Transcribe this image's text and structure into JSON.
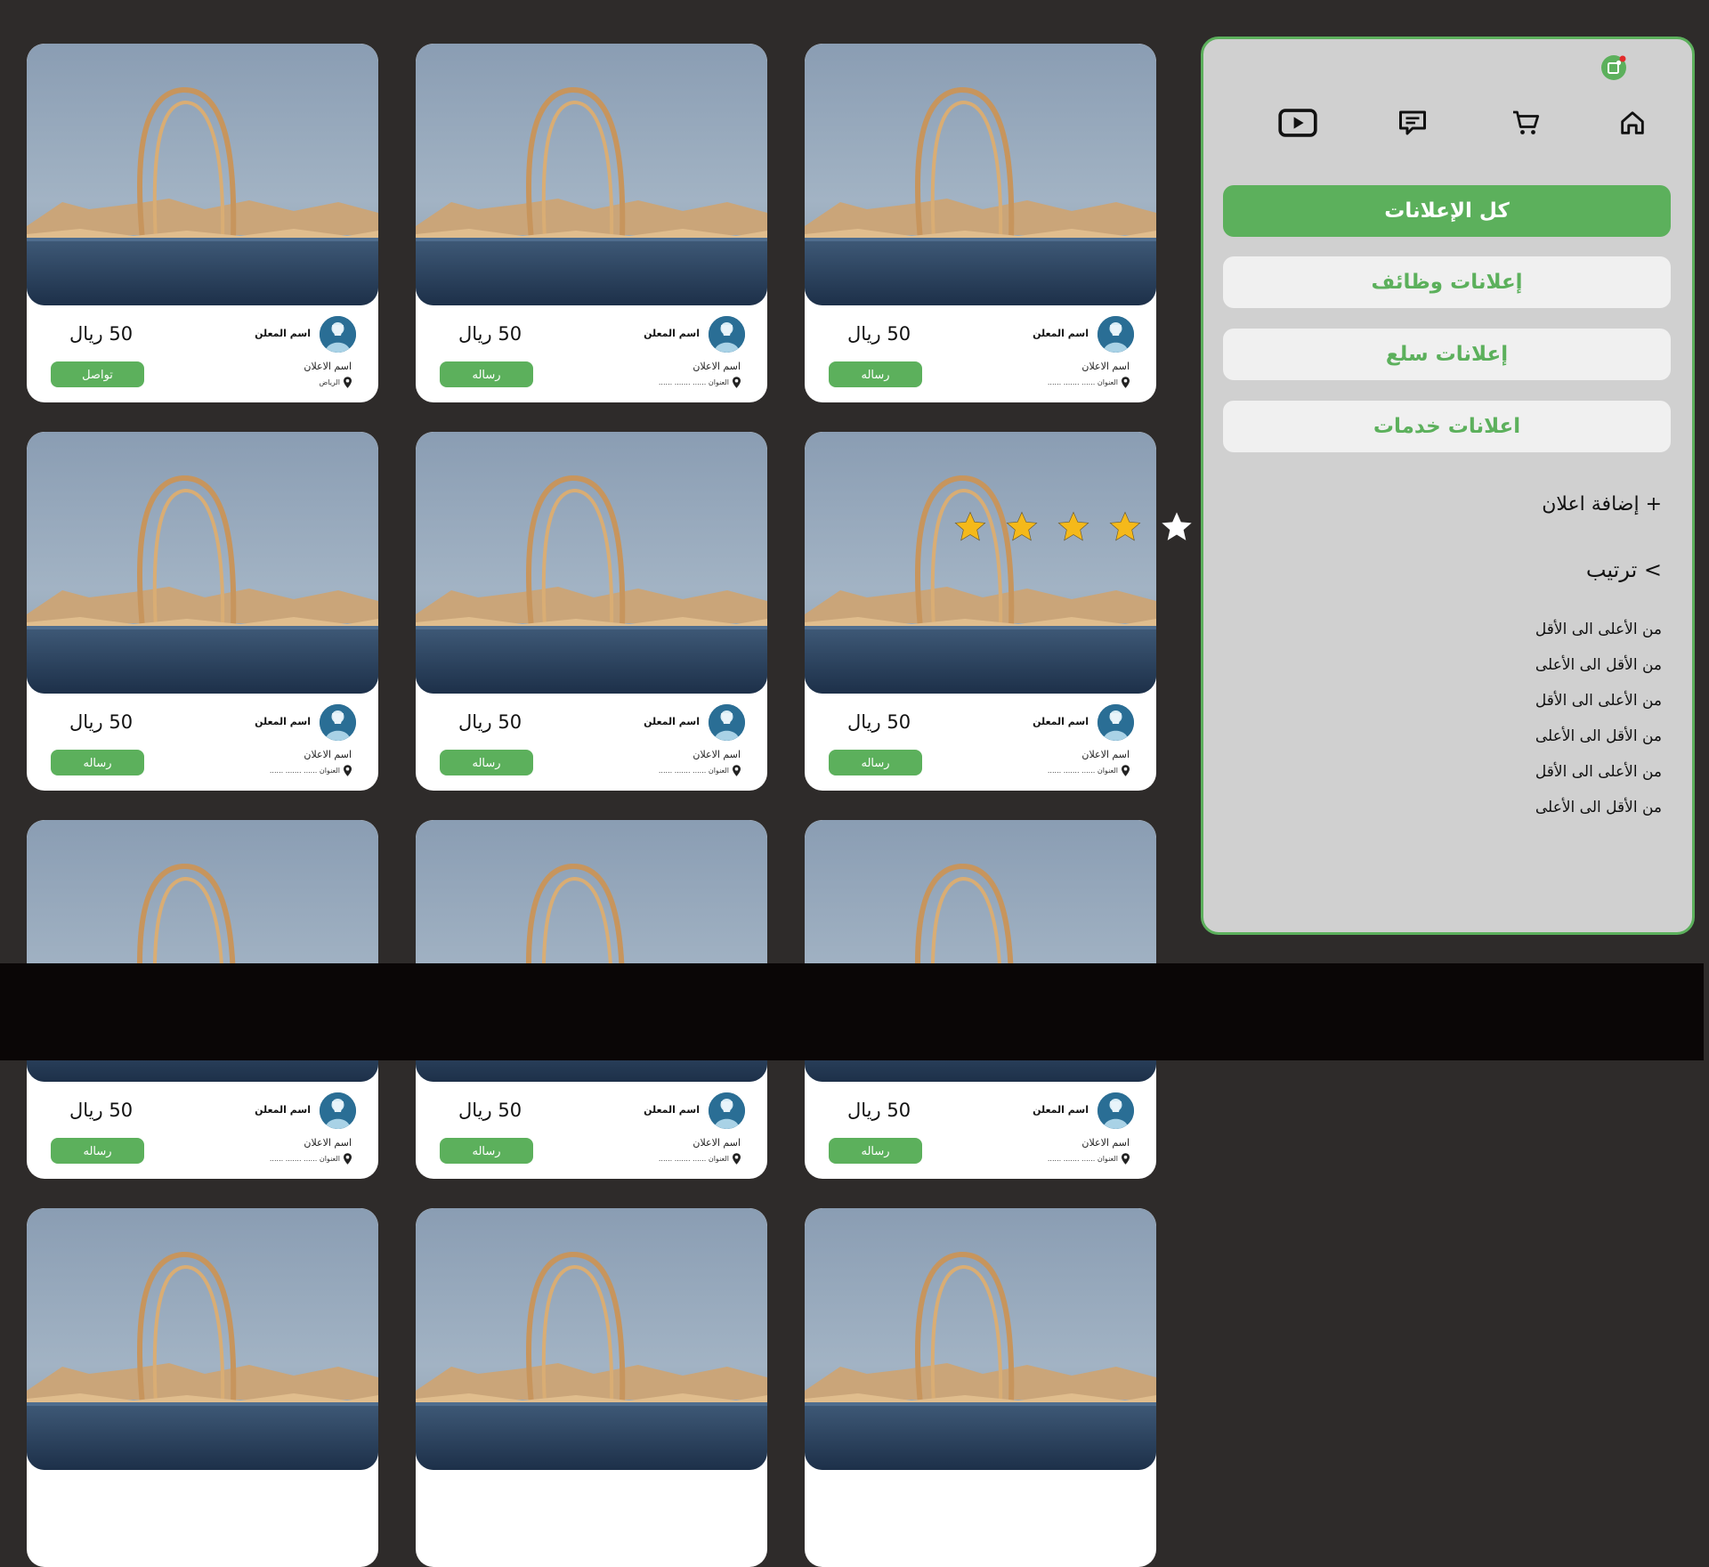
{
  "listings": [
    {
      "seller": "اسم المعلن",
      "price": "50 ريال",
      "ad_name": "اسم الاعلان",
      "address": "الرياض",
      "button": "تواصل"
    },
    {
      "seller": "اسم المعلن",
      "price": "50 ريال",
      "ad_name": "اسم الاعلان",
      "address": "العنوان ...... ....... ......",
      "button": "رساله"
    },
    {
      "seller": "اسم المعلن",
      "price": "50 ريال",
      "ad_name": "اسم الاعلان",
      "address": "العنوان ...... ....... ......",
      "button": "رساله"
    },
    {
      "seller": "اسم المعلن",
      "price": "50 ريال",
      "ad_name": "اسم الاعلان",
      "address": "العنوان ...... ....... ......",
      "button": "رساله"
    },
    {
      "seller": "اسم المعلن",
      "price": "50 ريال",
      "ad_name": "اسم الاعلان",
      "address": "العنوان ...... ....... ......",
      "button": "رساله"
    },
    {
      "seller": "اسم المعلن",
      "price": "50 ريال",
      "ad_name": "اسم الاعلان",
      "address": "العنوان ...... ....... ......",
      "button": "رساله"
    },
    {
      "seller": "اسم المعلن",
      "price": "50 ريال",
      "ad_name": "اسم الاعلان",
      "address": "العنوان ...... ....... ......",
      "button": "رساله"
    },
    {
      "seller": "اسم المعلن",
      "price": "50 ريال",
      "ad_name": "اسم الاعلان",
      "address": "العنوان ...... ....... ......",
      "button": "رساله"
    },
    {
      "seller": "اسم المعلن",
      "price": "50 ريال",
      "ad_name": "اسم الاعلان",
      "address": "العنوان ...... ....... ......",
      "button": "رساله"
    }
  ],
  "sidebar": {
    "nav_icons": [
      "home-icon",
      "cart-icon",
      "chat-icon",
      "video-icon"
    ],
    "menu": [
      {
        "label": "كل الإعلانات",
        "active": true
      },
      {
        "label": "إعلانات وظائف",
        "active": false
      },
      {
        "label": "إعلانات سلع",
        "active": false
      },
      {
        "label": "اعلانات خدمات",
        "active": false
      }
    ],
    "add_ad": "+ إضافة اعلان",
    "sort_title": "> ترتيب",
    "sort_options": [
      "من الأعلى الى الأقل",
      "من الأقل الى الأعلى",
      "من الأعلى الى الأقل",
      "من الأقل الى الأعلى",
      "من الأعلى الى الأقل",
      "من الأقل الى الأعلى"
    ]
  },
  "rating": {
    "value": 4,
    "max": 5
  },
  "colors": {
    "accent": "#5cb05c",
    "background": "#2e2b2a",
    "sidebar": "#d0d0d0",
    "star": "#f5b91a"
  }
}
